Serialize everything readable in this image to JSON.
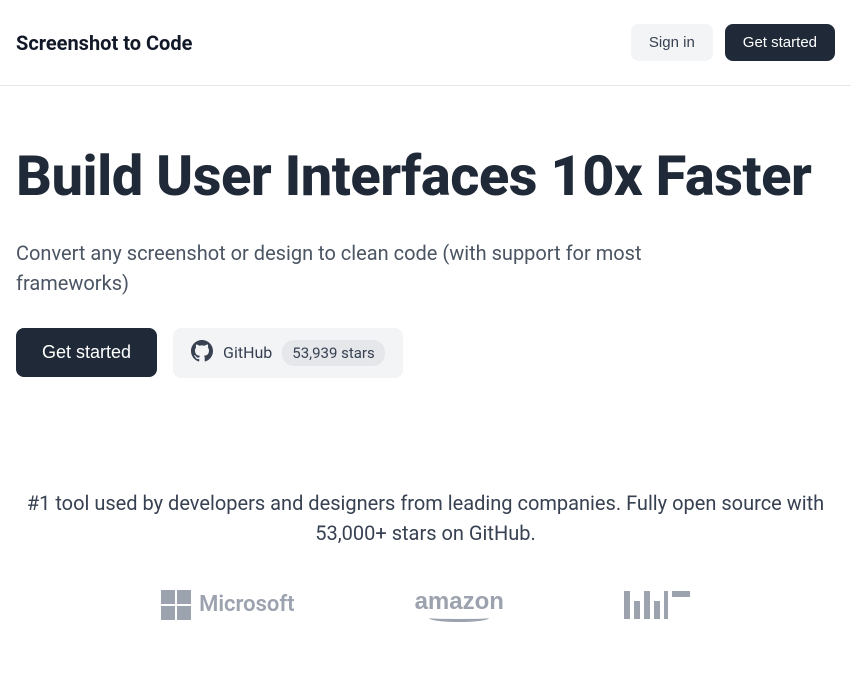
{
  "header": {
    "brand": "Screenshot to Code",
    "signin": "Sign in",
    "getstarted": "Get started"
  },
  "hero": {
    "title": "Build User Interfaces 10x Faster",
    "subtitle": "Convert any screenshot or design to clean code (with support for most frameworks)",
    "cta": "Get started",
    "github_label": "GitHub",
    "github_stars": "53,939 stars"
  },
  "social": {
    "text": "#1 tool used by developers and designers from leading companies. Fully open source with 53,000+ stars on GitHub.",
    "logos": {
      "microsoft": "Microsoft",
      "amazon": "amazon",
      "mit": "MIT"
    }
  }
}
